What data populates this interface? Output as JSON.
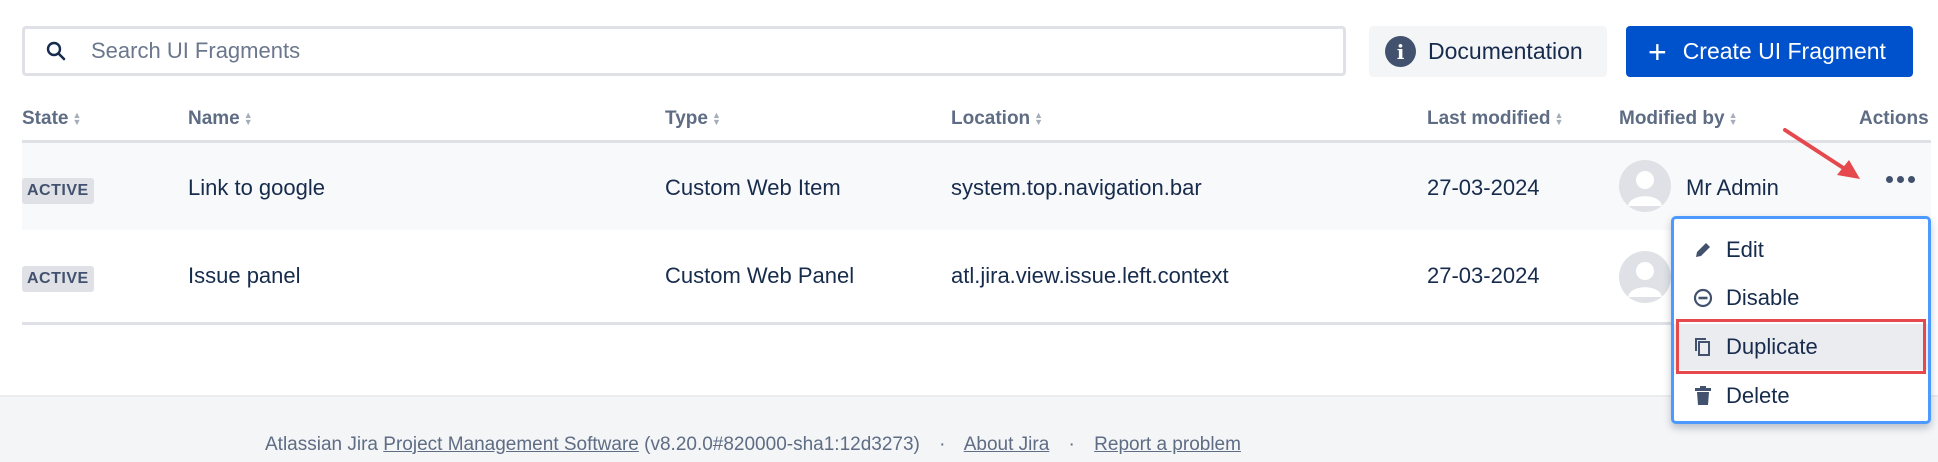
{
  "search": {
    "placeholder": "Search UI Fragments"
  },
  "toolbar": {
    "documentation_label": "Documentation",
    "create_label": "Create UI Fragment"
  },
  "table": {
    "headers": {
      "state": "State",
      "name": "Name",
      "type": "Type",
      "location": "Location",
      "last_modified": "Last modified",
      "modified_by": "Modified by",
      "actions": "Actions"
    },
    "rows": [
      {
        "state": "ACTIVE",
        "name": "Link to google",
        "type": "Custom Web Item",
        "location": "system.top.navigation.bar",
        "last_modified": "27-03-2024",
        "modified_by": "Mr Admin"
      },
      {
        "state": "ACTIVE",
        "name": "Issue panel",
        "type": "Custom Web Panel",
        "location": "atl.jira.view.issue.left.context",
        "last_modified": "27-03-2024",
        "modified_by": ""
      }
    ]
  },
  "actions_menu": {
    "items": [
      {
        "label": "Edit",
        "icon": "pencil-icon"
      },
      {
        "label": "Disable",
        "icon": "minus-circle-icon"
      },
      {
        "label": "Duplicate",
        "icon": "copy-icon"
      },
      {
        "label": "Delete",
        "icon": "trash-icon"
      }
    ]
  },
  "footer": {
    "prefix": "Atlassian Jira",
    "product_link": "Project Management Software",
    "version": "(v8.20.0#820000-sha1:12d3273)",
    "sep": "·",
    "about_link": "About Jira",
    "report_link": "Report a problem"
  },
  "colors": {
    "primary": "#0052cc",
    "highlight": "#e5484d",
    "focus": "#4c9aff"
  }
}
